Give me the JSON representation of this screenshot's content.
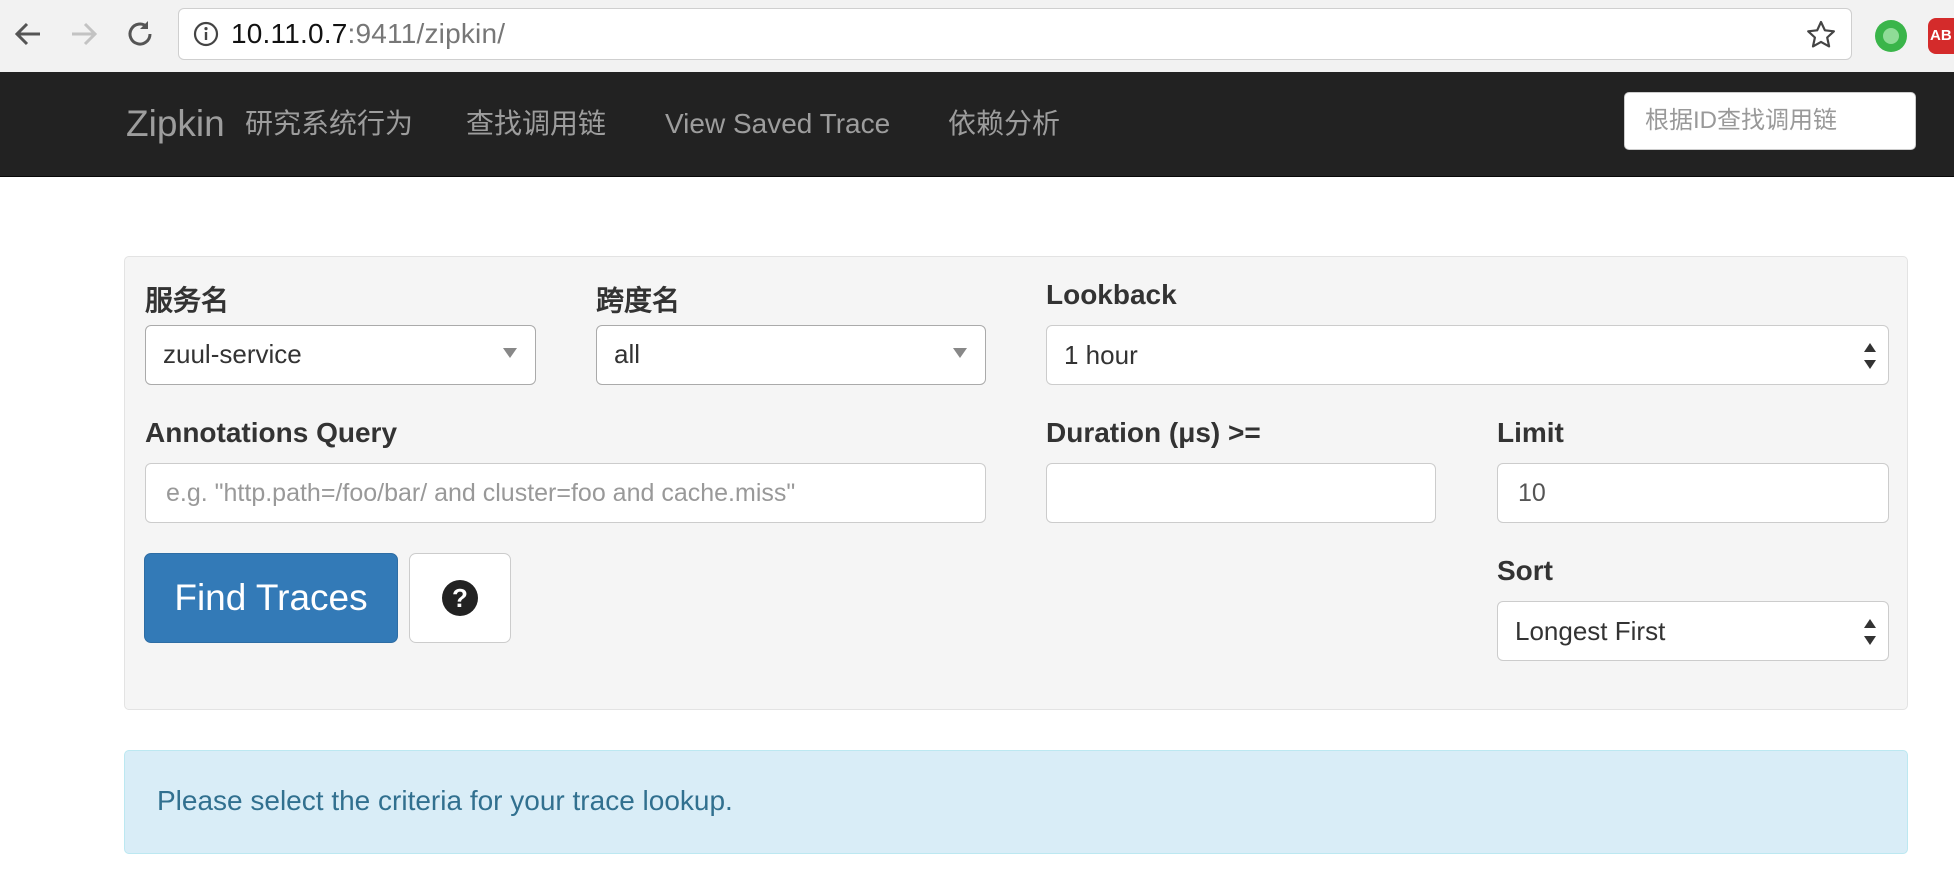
{
  "browser": {
    "url_host": "10.11.0.7",
    "url_rest": ":9411/zipkin/",
    "extensions": [
      "green-circle-extension-icon",
      "adblock-icon"
    ],
    "adblock_label": "AB"
  },
  "navbar": {
    "brand": "Zipkin",
    "links": [
      "研究系统行为",
      "查找调用链",
      "View Saved Trace",
      "依赖分析"
    ],
    "id_search_placeholder": "根据ID查找调用链"
  },
  "search": {
    "service_label": "服务名",
    "service_value": "zuul-service",
    "span_label": "跨度名",
    "span_value": "all",
    "lookback_label": "Lookback",
    "lookback_value": "1 hour",
    "annotations_label": "Annotations Query",
    "annotations_placeholder": "e.g. \"http.path=/foo/bar/ and cluster=foo and cache.miss\"",
    "duration_label": "Duration (μs) >=",
    "duration_value": "",
    "limit_label": "Limit",
    "limit_value": "10",
    "sort_label": "Sort",
    "sort_value": "Longest First",
    "find_button": "Find Traces",
    "help_glyph": "?"
  },
  "alert": {
    "message": "Please select the criteria for your trace lookup."
  },
  "colors": {
    "navbar_bg": "#222222",
    "primary": "#337ab7",
    "alert_bg": "#d9edf7",
    "alert_text": "#31708f",
    "panel_bg": "#f5f5f5"
  }
}
